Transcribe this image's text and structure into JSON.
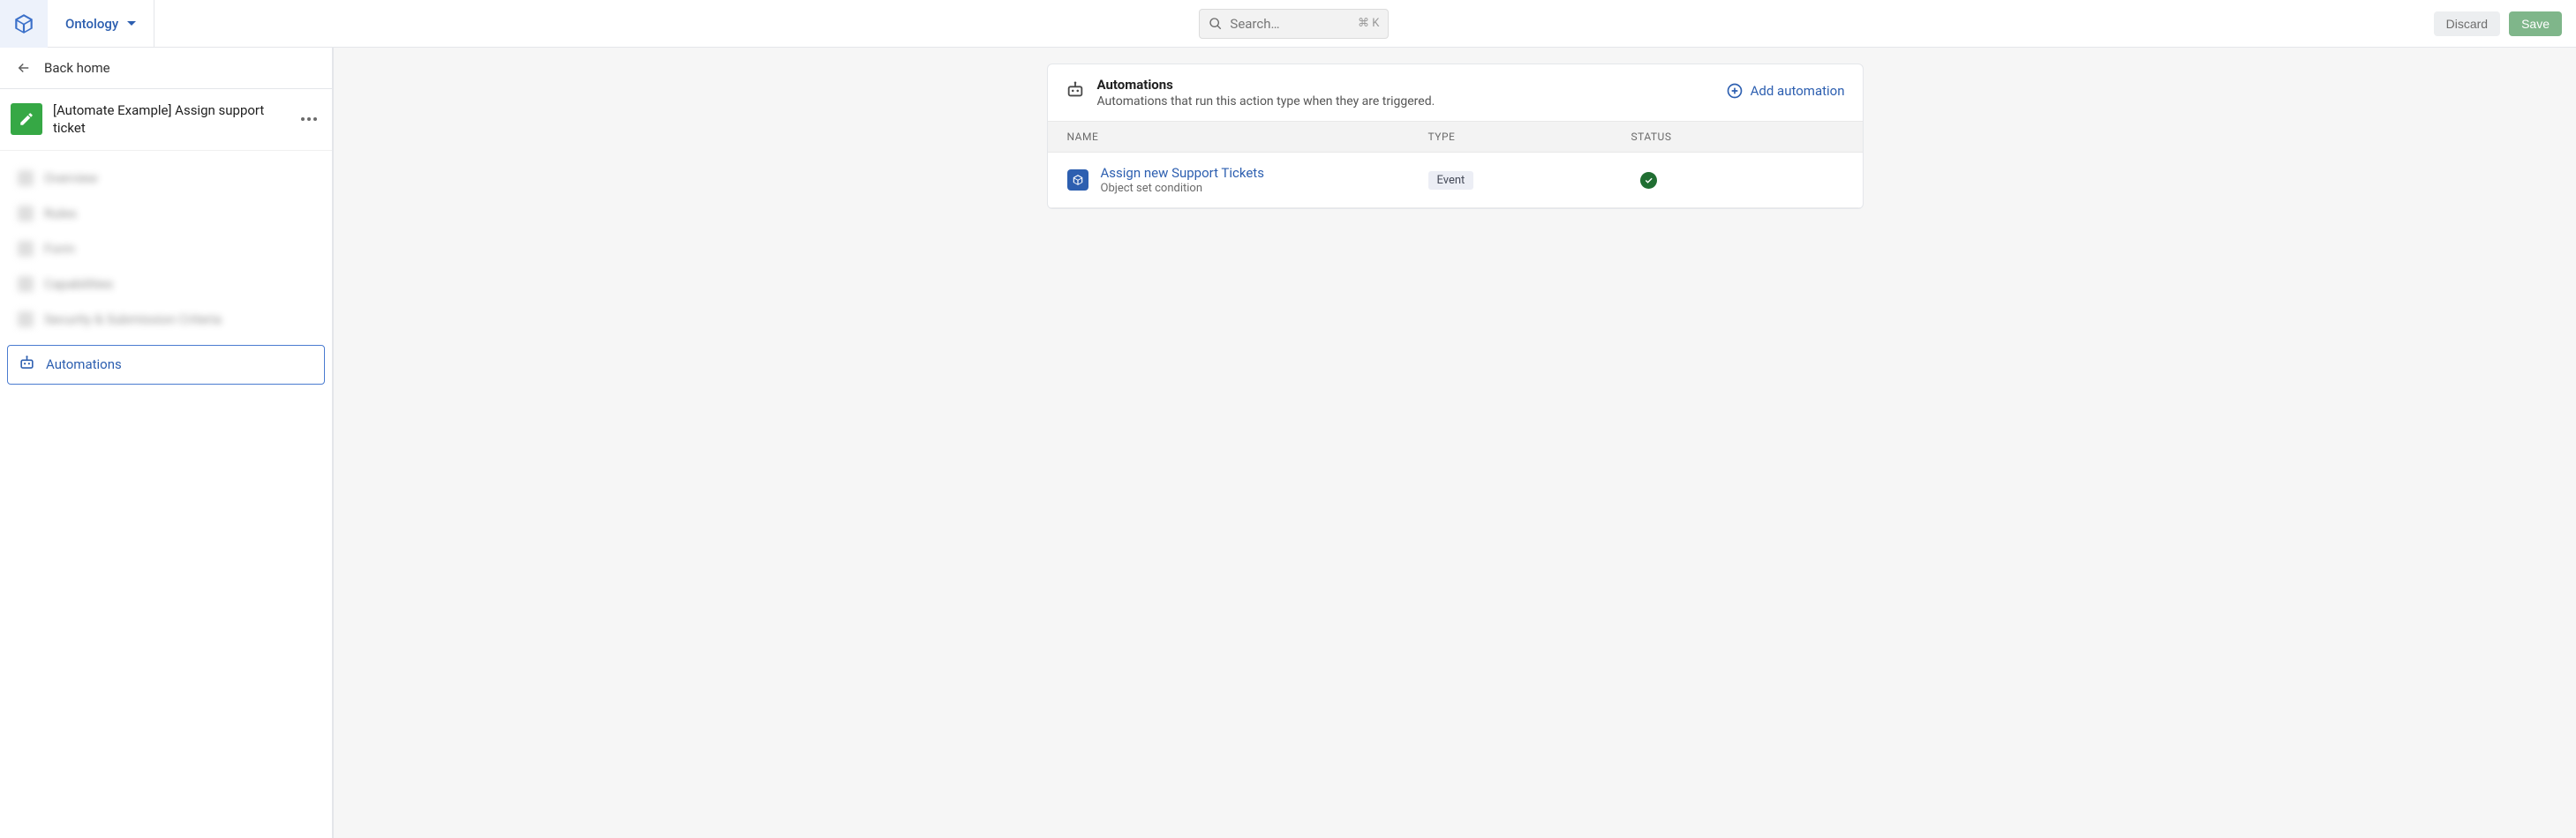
{
  "topbar": {
    "brand_dropdown": "Ontology",
    "search_placeholder": "Search…",
    "search_kbd": "⌘ K",
    "discard_label": "Discard",
    "save_label": "Save"
  },
  "sidebar": {
    "back_label": "Back home",
    "page_title": "[Automate Example] Assign support ticket",
    "nav": {
      "blurred_items": [
        "Overview",
        "Rules",
        "Form",
        "Capabilities",
        "Security & Submission Criteria"
      ],
      "active_label": "Automations"
    }
  },
  "panel": {
    "title": "Automations",
    "subtitle": "Automations that run this action type when they are triggered.",
    "add_label": "Add automation",
    "columns": {
      "name": "Name",
      "type": "Type",
      "status": "Status"
    },
    "rows": [
      {
        "name": "Assign new Support Tickets",
        "sub": "Object set condition",
        "type_badge": "Event",
        "status": "ok"
      }
    ]
  }
}
